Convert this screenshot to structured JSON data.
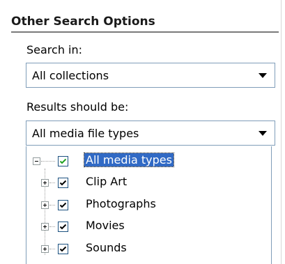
{
  "section": {
    "title": "Other Search Options"
  },
  "search_in": {
    "label": "Search in:",
    "selected": "All collections"
  },
  "results": {
    "label": "Results should be:",
    "selected": "All media file types"
  },
  "tree": {
    "root": {
      "label": "All media types",
      "checked": true,
      "expanded": true,
      "selected": true
    },
    "children": [
      {
        "label": "Clip Art",
        "checked": true,
        "expanded": false
      },
      {
        "label": "Photographs",
        "checked": true,
        "expanded": false
      },
      {
        "label": "Movies",
        "checked": true,
        "expanded": false
      },
      {
        "label": "Sounds",
        "checked": true,
        "expanded": false
      }
    ]
  },
  "colors": {
    "selection": "#316ac5",
    "border": "#7f9db9",
    "rule": "#7a7a7a"
  }
}
